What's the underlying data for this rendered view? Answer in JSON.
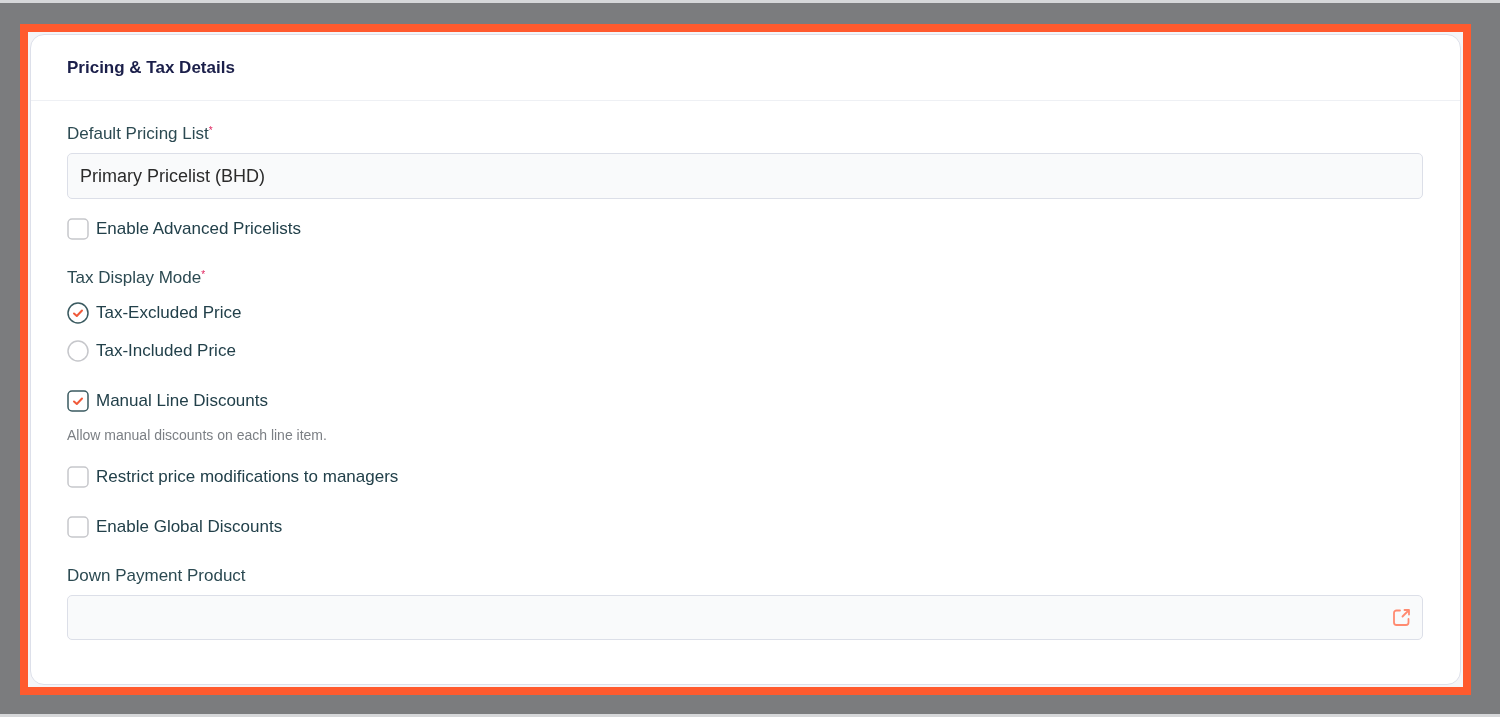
{
  "card": {
    "title": "Pricing & Tax Details"
  },
  "form": [
    {
      "kind": "select",
      "label": "Default Pricing List$^{*}$",
      "value": "Primary Pricelist (BHD)"
    },
    {
      "kind": "checkbox",
      "label": "Enable Advanced Pricelists",
      "checked": false
    },
    {
      "kind": "radio_group",
      "label": "Tax Display Mode$^{*}$",
      "options": [
        {
          "label": "Tax-Excluded Price",
          "selected": true
        },
        {
          "label": "Tax-Included Price",
          "selected": false
        }
      ]
    },
    {
      "kind": "checkbox",
      "label": "Manual Line Discounts",
      "checked": true,
      "help": "Allow manual discounts on each line item."
    },
    {
      "kind": "checkbox",
      "label": "Restrict price modifications to managers",
      "checked": false
    },
    {
      "kind": "checkbox",
      "label": "Enable Global Discounts",
      "checked": false
    },
    {
      "kind": "lookup",
      "label": "Down Payment Product"
    }
  ]
}
